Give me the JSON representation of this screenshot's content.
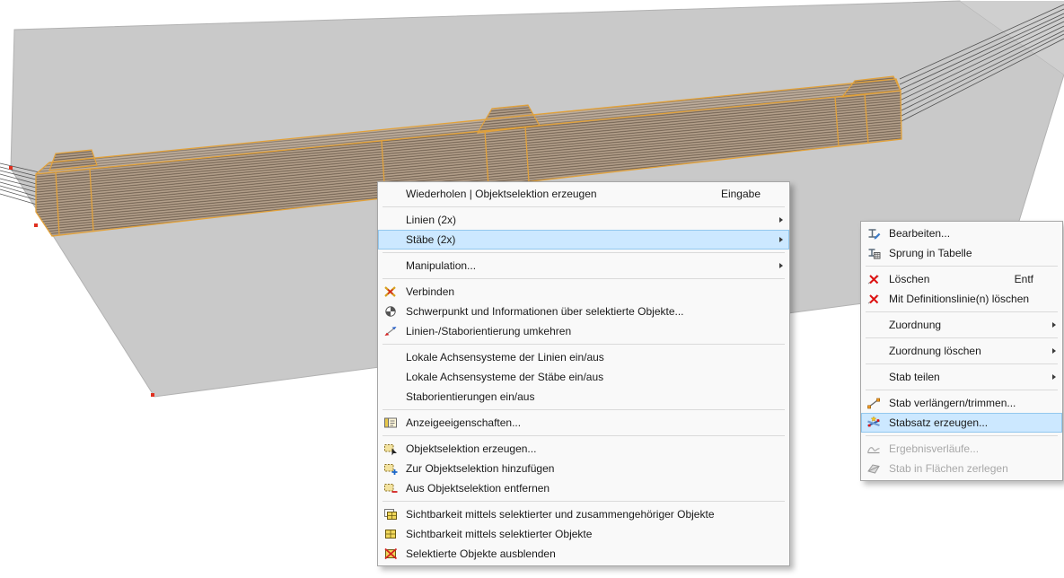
{
  "colors": {
    "background": "#ffffff",
    "plane_gray": "#c9c9c9",
    "plane_gray_light": "#cfcfcf",
    "beam_fill": "#b4a08b",
    "beam_hatch_line": "#6e5e4e",
    "selection_orange": "#e2a23b",
    "node_red": "#e03020",
    "menu_bg": "#f9f9f9",
    "menu_border": "#a6a6a6",
    "menu_text": "#1a1a1a",
    "menu_highlight": "#cce8ff",
    "menu_highlight_border": "#93c8ee",
    "menu_disabled_text": "#a8a8a8",
    "separator": "#dadada"
  },
  "menus": {
    "main": {
      "items": [
        {
          "label": "Wiederholen | Objektselektion erzeugen",
          "shortcut": "Eingabe"
        },
        {
          "label": "Linien (2x)",
          "has_submenu": true
        },
        {
          "label": "Stäbe (2x)",
          "has_submenu": true,
          "highlighted": true
        },
        {
          "label": "Manipulation...",
          "has_submenu": true
        },
        {
          "label": "Verbinden",
          "icon": "connect-icon"
        },
        {
          "label": "Schwerpunkt und Informationen über selektierte Objekte...",
          "icon": "center-of-gravity-icon"
        },
        {
          "label": "Linien-/Staborientierung umkehren",
          "icon": "reverse-orientation-icon"
        },
        {
          "label": "Lokale Achsensysteme der Linien ein/aus"
        },
        {
          "label": "Lokale Achsensysteme der Stäbe ein/aus"
        },
        {
          "label": "Staborientierungen ein/aus"
        },
        {
          "label": "Anzeigeeigenschaften...",
          "icon": "display-properties-icon"
        },
        {
          "label": "Objektselektion erzeugen...",
          "icon": "create-object-selection-icon"
        },
        {
          "label": "Zur Objektselektion hinzufügen",
          "icon": "add-to-object-selection-icon"
        },
        {
          "label": "Aus Objektselektion entfernen",
          "icon": "remove-from-object-selection-icon"
        },
        {
          "label": "Sichtbarkeit mittels selektierter und zusammengehöriger Objekte",
          "icon": "visibility-related-objects-icon"
        },
        {
          "label": "Sichtbarkeit mittels selektierter Objekte",
          "icon": "visibility-selected-objects-icon"
        },
        {
          "label": "Selektierte Objekte ausblenden",
          "icon": "hide-selected-objects-icon"
        }
      ]
    },
    "sub": {
      "items": [
        {
          "label": "Bearbeiten...",
          "icon": "edit-member-icon"
        },
        {
          "label": "Sprung in Tabelle",
          "icon": "jump-to-table-icon"
        },
        {
          "label": "Löschen",
          "shortcut": "Entf",
          "icon": "delete-member-icon"
        },
        {
          "label": "Mit Definitionslinie(n) löschen",
          "icon": "delete-with-definition-line-icon"
        },
        {
          "label": "Zuordnung",
          "has_submenu": true
        },
        {
          "label": "Zuordnung löschen",
          "has_submenu": true
        },
        {
          "label": "Stab teilen",
          "has_submenu": true
        },
        {
          "label": "Stab verlängern/trimmen...",
          "icon": "extend-trim-member-icon"
        },
        {
          "label": "Stabsatz erzeugen...",
          "icon": "create-member-set-icon",
          "highlighted": true
        },
        {
          "label": "Ergebnisverläufe...",
          "icon": "result-diagrams-icon",
          "disabled": true
        },
        {
          "label": "Stab in Flächen zerlegen",
          "icon": "member-to-surfaces-icon",
          "disabled": true
        }
      ]
    }
  }
}
